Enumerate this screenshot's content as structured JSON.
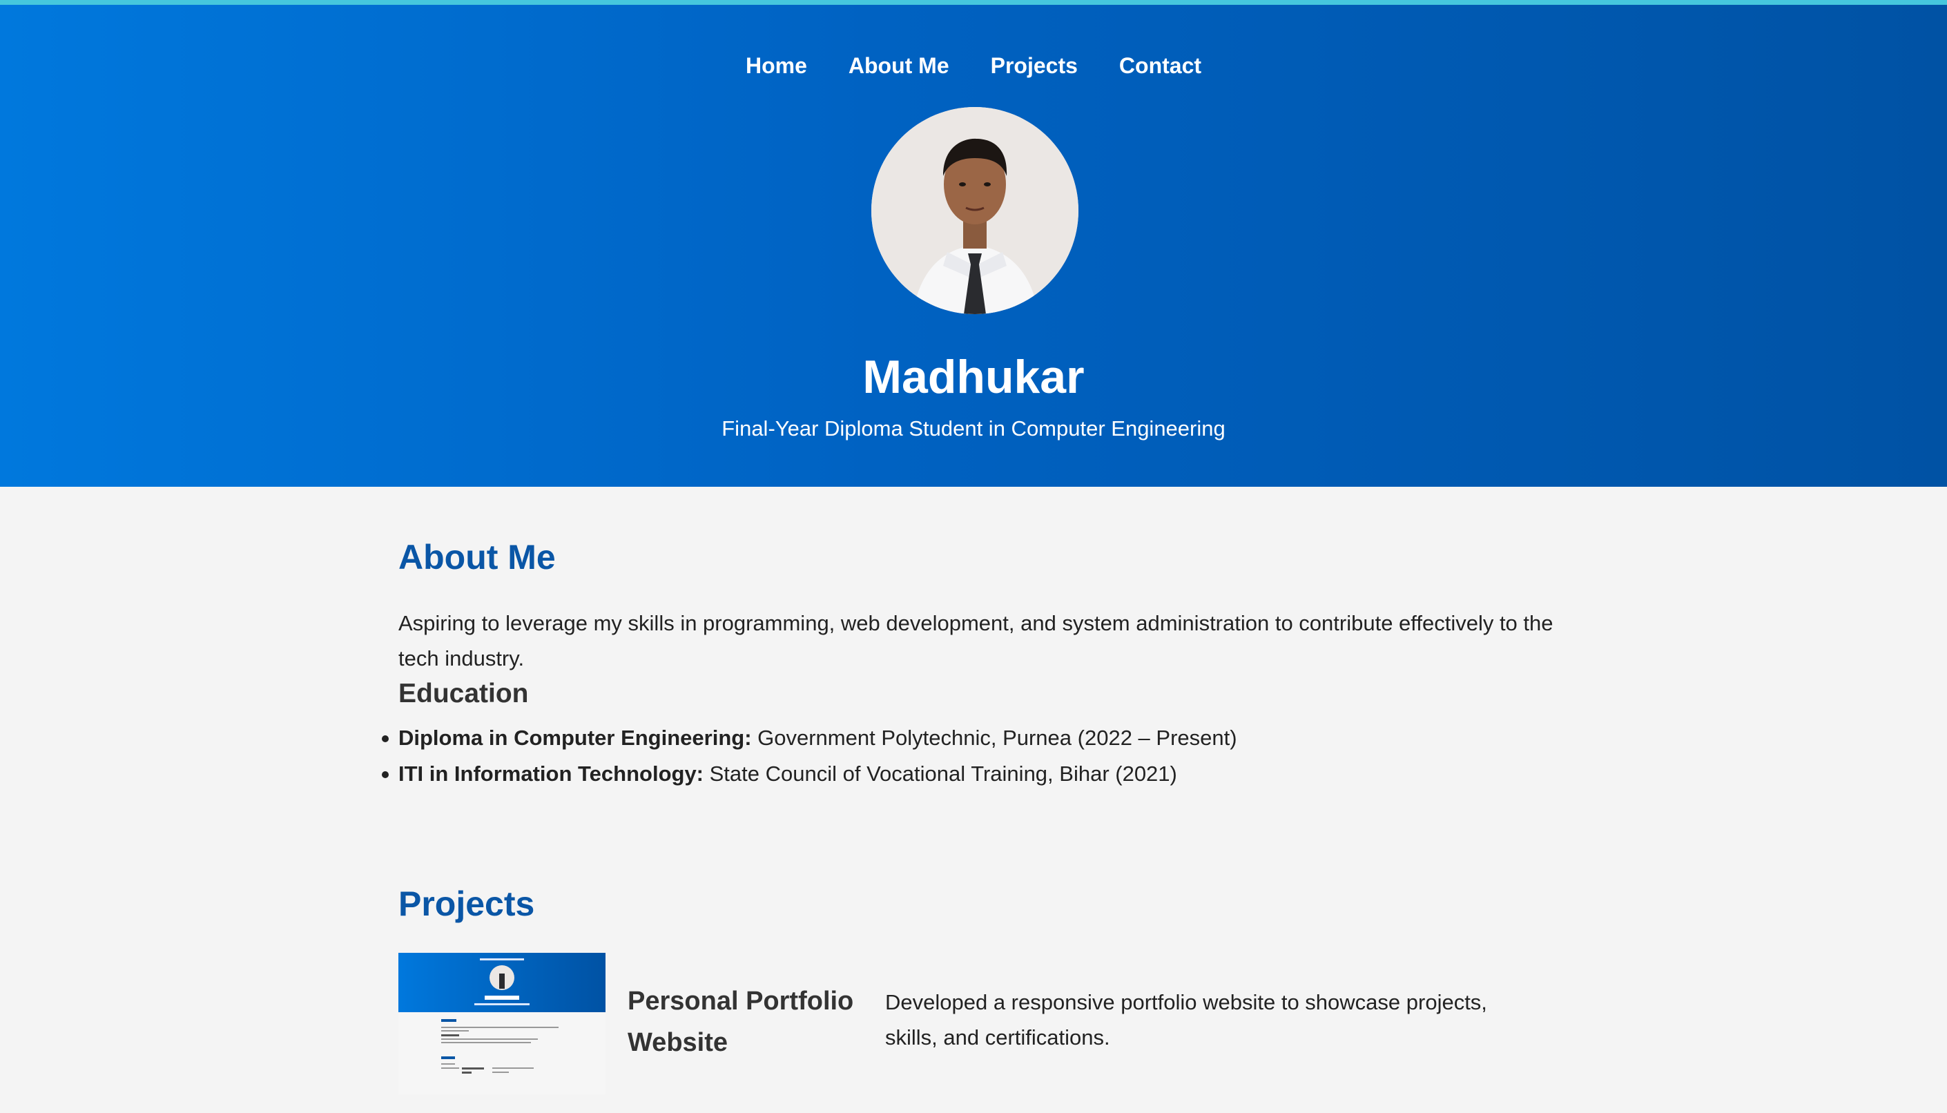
{
  "nav": {
    "items": [
      {
        "label": "Home"
      },
      {
        "label": "About Me"
      },
      {
        "label": "Projects"
      },
      {
        "label": "Contact"
      }
    ]
  },
  "hero": {
    "name": "Madhukar",
    "subtitle": "Final-Year Diploma Student in Computer Engineering"
  },
  "about": {
    "title": "About Me",
    "text": "Aspiring to leverage my skills in programming, web development, and system administration to contribute effectively to the tech industry."
  },
  "education": {
    "title": "Education",
    "items": [
      {
        "degree": "Diploma in Computer Engineering:",
        "detail": " Government Polytechnic, Purnea (2022 – Present)"
      },
      {
        "degree": "ITI in Information Technology:",
        "detail": " State Council of Vocational Training, Bihar (2021)"
      }
    ]
  },
  "projects": {
    "title": "Projects",
    "items": [
      {
        "name": "Personal Portfolio Website",
        "description": "Developed a responsive portfolio website to showcase projects, skills, and certifications."
      }
    ]
  },
  "colors": {
    "accent_top": "#45c7dd",
    "hero_start": "#0078dd",
    "hero_end": "#0052a4",
    "heading_blue": "#0a56a6",
    "page_bg": "#f4f4f4"
  }
}
